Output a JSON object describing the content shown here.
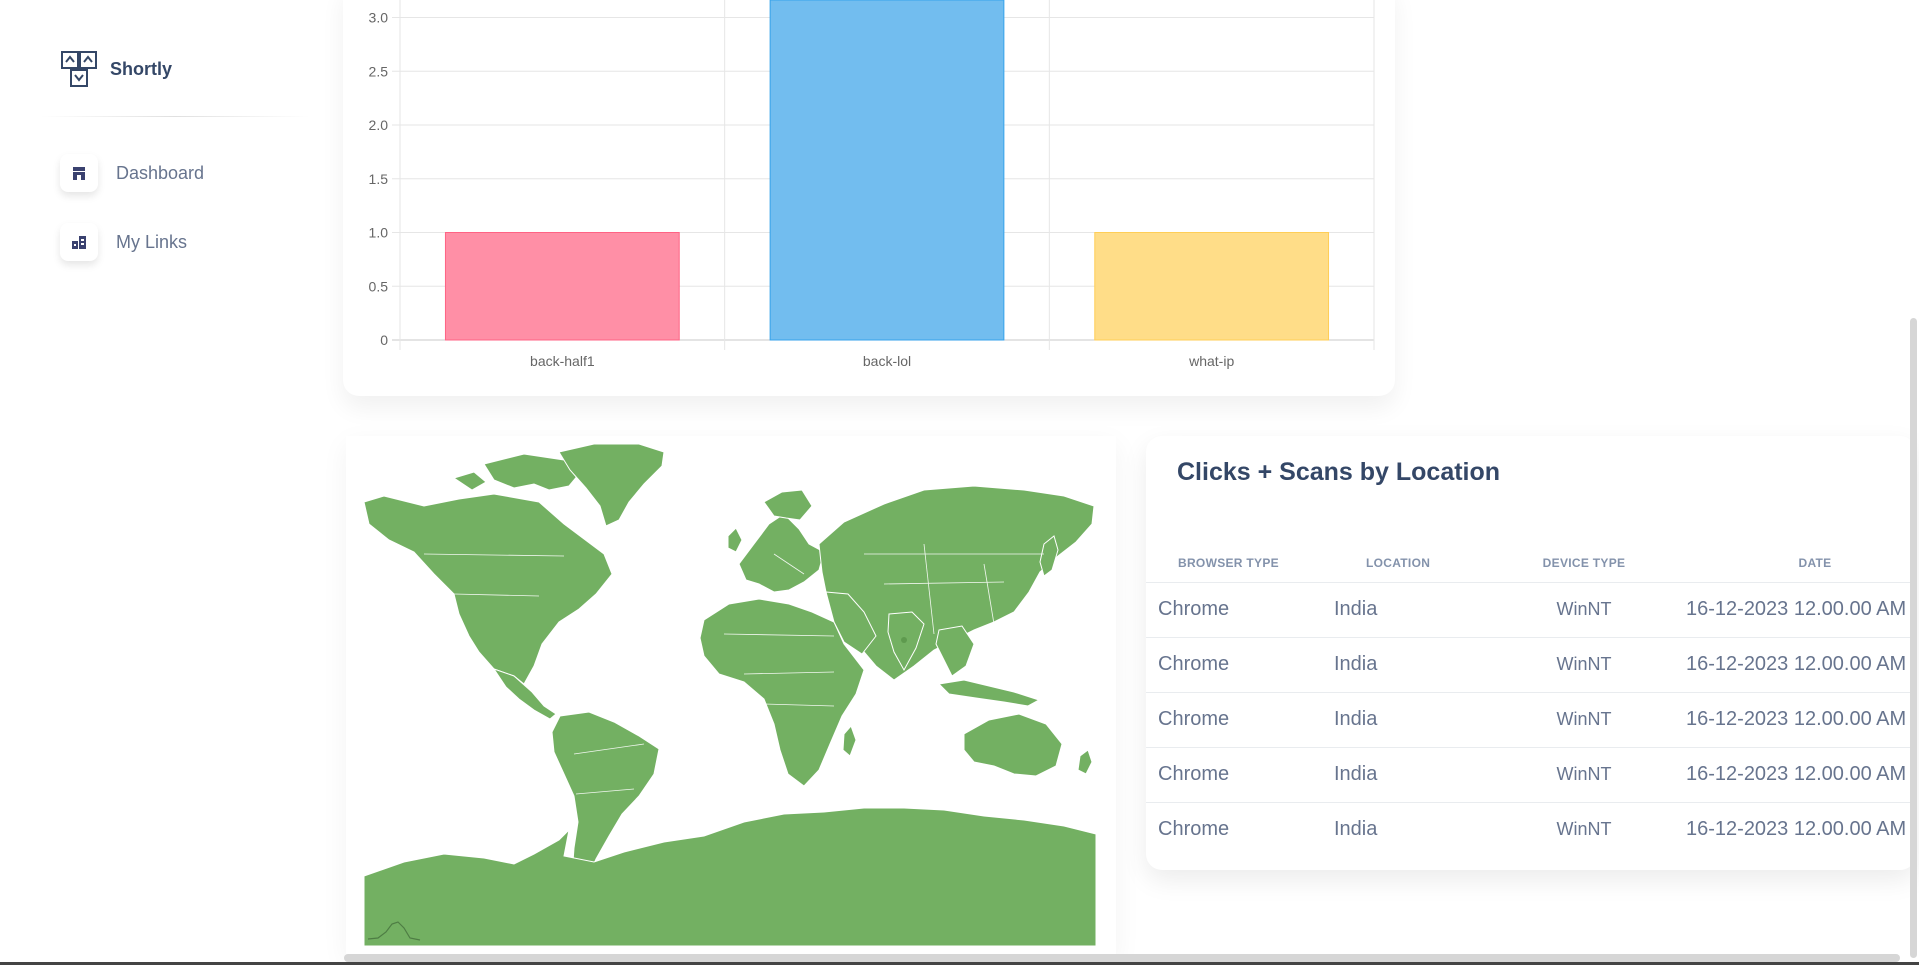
{
  "app": {
    "brand_name": "Shortly"
  },
  "sidebar": {
    "items": [
      {
        "label": "Dashboard",
        "icon": "shop-icon"
      },
      {
        "label": "My Links",
        "icon": "office-icon"
      }
    ]
  },
  "chart_data": {
    "type": "bar",
    "categories": [
      "back-half1",
      "back-lol",
      "what-ip"
    ],
    "values": [
      1,
      3.2,
      1
    ],
    "colors": [
      "#ff8fa6",
      "#72bdef",
      "#ffdd88"
    ],
    "border_colors": [
      "#ff6384",
      "#36a2eb",
      "#ffce56"
    ],
    "y_ticks": [
      "0",
      "0.5",
      "1.0",
      "1.5",
      "2.0",
      "2.5",
      "3.0"
    ],
    "ylim": [
      0,
      3.2
    ],
    "grid": true,
    "title": "",
    "xlabel": "",
    "ylabel": ""
  },
  "map": {
    "land_color": "#73b062"
  },
  "location_table": {
    "title": "Clicks + Scans by Location",
    "headers": [
      "Browser Type",
      "Location",
      "Device Type",
      "Date"
    ],
    "rows": [
      [
        "Chrome",
        "India",
        "WinNT",
        "16-12-2023 12.00.00 AM"
      ],
      [
        "Chrome",
        "India",
        "WinNT",
        "16-12-2023 12.00.00 AM"
      ],
      [
        "Chrome",
        "India",
        "WinNT",
        "16-12-2023 12.00.00 AM"
      ],
      [
        "Chrome",
        "India",
        "WinNT",
        "16-12-2023 12.00.00 AM"
      ],
      [
        "Chrome",
        "India",
        "WinNT",
        "16-12-2023 12.00.00 AM"
      ]
    ]
  }
}
